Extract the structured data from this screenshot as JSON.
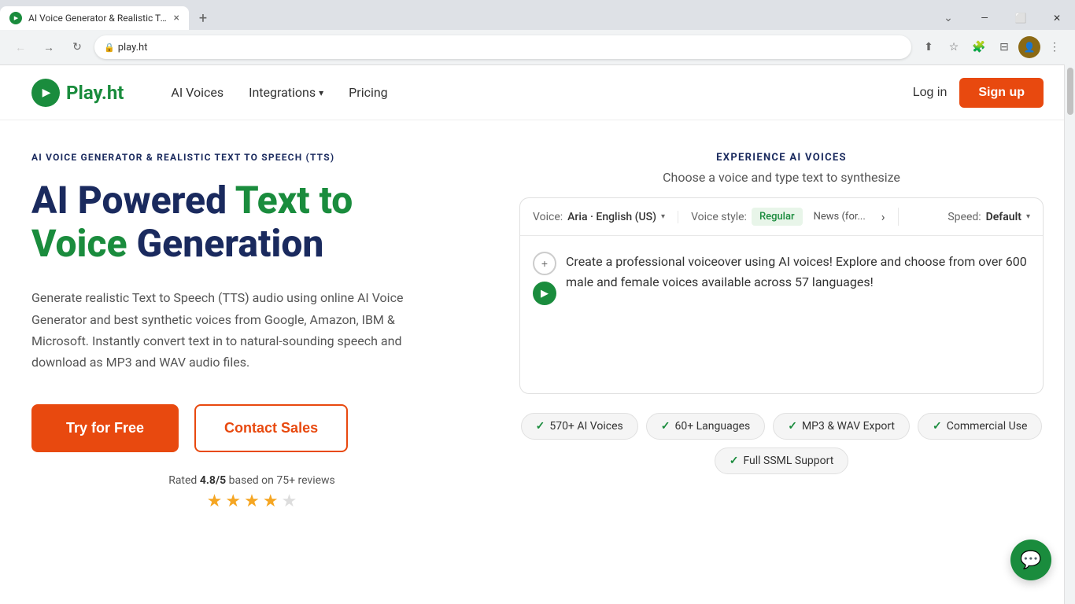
{
  "browser": {
    "tab": {
      "favicon_alt": "Play.ht favicon",
      "title": "AI Voice Generator & Realistic Te...",
      "close_label": "×"
    },
    "new_tab_label": "+",
    "window_controls": {
      "minimize": "—",
      "maximize": "⬜",
      "close": "✕"
    },
    "nav": {
      "back_label": "←",
      "forward_label": "→",
      "refresh_label": "↻",
      "url": "play.ht"
    },
    "address_bar_icons": {
      "share": "⬆",
      "star": "☆",
      "extension": "🧩",
      "split": "⊟",
      "menu": "⋮"
    }
  },
  "nav": {
    "logo_text_dark": "Play",
    "logo_text_dot": ".",
    "logo_text_light": "ht",
    "links": [
      {
        "label": "AI Voices",
        "dropdown": false
      },
      {
        "label": "Integrations",
        "dropdown": true
      },
      {
        "label": "Pricing",
        "dropdown": false
      }
    ],
    "login_label": "Log in",
    "signup_label": "Sign up"
  },
  "hero": {
    "eyebrow": "AI Voice Generator & Realistic Text to Speech (TTS)",
    "title_dark1": "AI Powered ",
    "title_green": "Text to",
    "title_newline": " ",
    "title_green2": "Voice",
    "title_dark2": " Generation",
    "description": "Generate realistic Text to Speech (TTS) audio using online AI Voice Generator and best synthetic voices from Google, Amazon, IBM & Microsoft. Instantly convert text in to natural-sounding speech and download as MP3 and WAV audio files.",
    "try_free_label": "Try for Free",
    "contact_sales_label": "Contact Sales",
    "rating_text_prefix": "Rated ",
    "rating_value": "4.8/5",
    "rating_text_suffix": " based on 75+ reviews",
    "stars": [
      "full",
      "full",
      "full",
      "half",
      "empty"
    ]
  },
  "demo": {
    "section_title": "Experience AI Voices",
    "subtitle": "Choose a voice and type text to synthesize",
    "voice_label": "Voice:",
    "voice_name": "Aria · English (US)",
    "style_label": "Voice style:",
    "style_tabs": [
      {
        "label": "Regular",
        "active": true
      },
      {
        "label": "News (for...",
        "active": false
      }
    ],
    "speed_label": "Speed:",
    "speed_value": "Default",
    "demo_text": "Create a professional voiceover using AI voices! Explore and choose from over 600 male and female voices available across 57 languages!",
    "add_btn_label": "+",
    "play_btn_label": "▶"
  },
  "badges": [
    {
      "label": "570+ AI Voices"
    },
    {
      "label": "60+ Languages"
    },
    {
      "label": "MP3 & WAV Export"
    },
    {
      "label": "Commercial Use"
    },
    {
      "label": "Full SSML Support"
    }
  ],
  "chat": {
    "icon": "💬"
  }
}
